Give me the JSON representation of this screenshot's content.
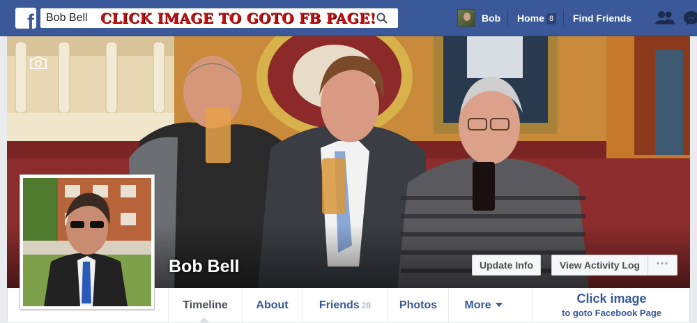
{
  "topbar": {
    "logo_letter": "f",
    "search_value": "Bob Bell",
    "search_banner": "CLICK IMAGE TO GOTO FB PAGE!",
    "user_name": "Bob",
    "home_label": "Home",
    "home_badge": "8",
    "find_friends_label": "Find Friends"
  },
  "cover": {
    "profile_name": "Bob Bell",
    "update_info_label": "Update Info",
    "activity_log_label": "View Activity Log",
    "more_label": "···"
  },
  "tabs": {
    "timeline": "Timeline",
    "about": "About",
    "friends": "Friends",
    "friends_count": "28",
    "photos": "Photos",
    "more": "More"
  },
  "cta": {
    "line1": "Click image",
    "line2": "to goto Facebook Page"
  },
  "colors": {
    "brand_blue": "#3b5998",
    "link_blue": "#365899",
    "banner_red": "#c01010"
  },
  "icons": [
    "facebook-logo-icon",
    "search-icon",
    "friend-requests-icon",
    "messages-icon",
    "camera-icon",
    "more-caret-icon"
  ]
}
